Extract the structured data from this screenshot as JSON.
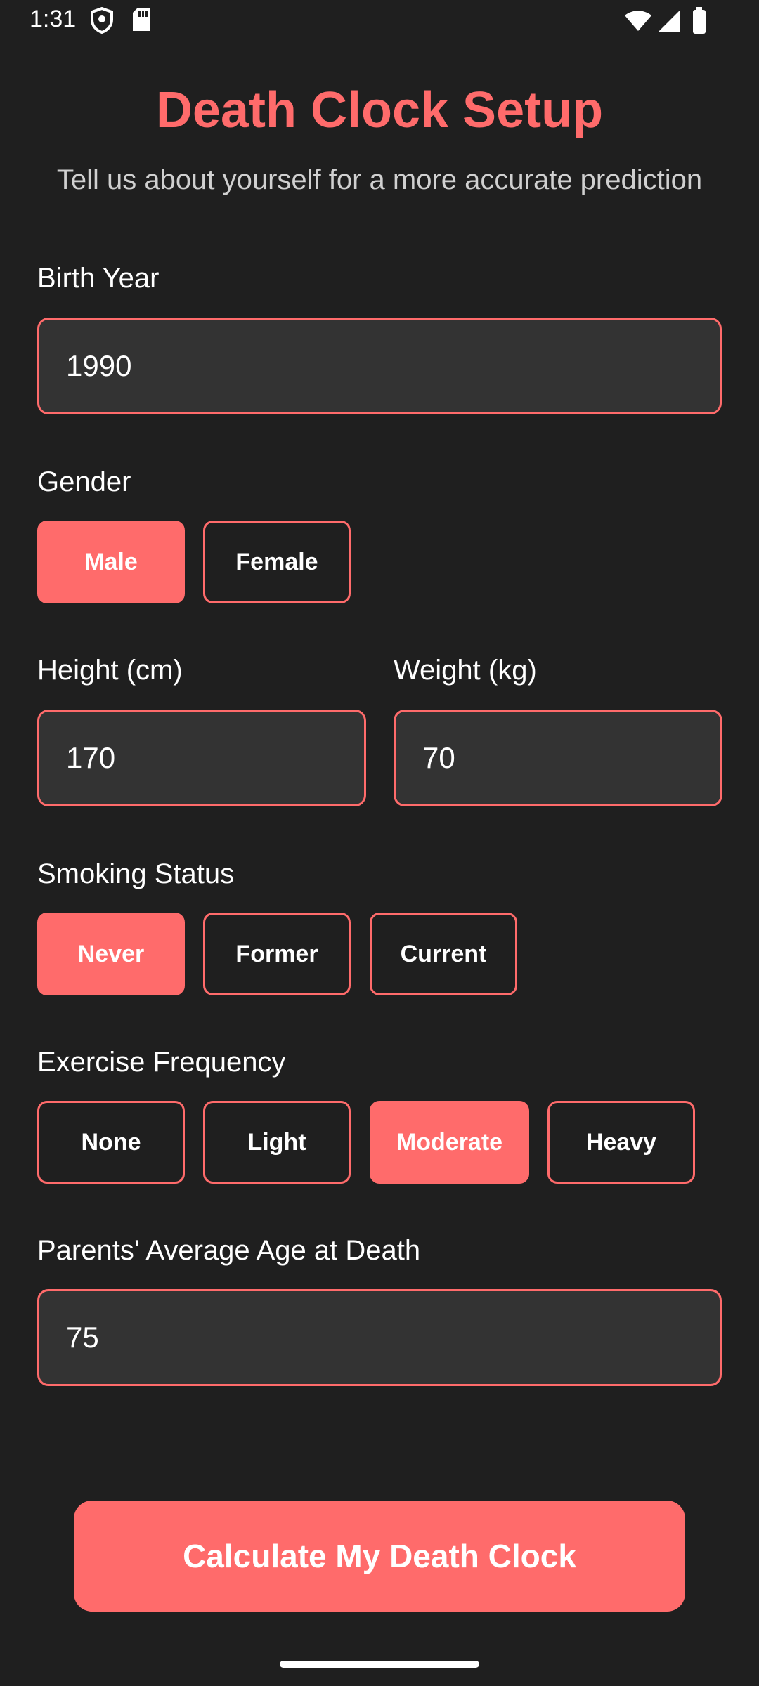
{
  "status_bar": {
    "time": "1:31",
    "icons": [
      "shield-icon",
      "sd-card-icon",
      "wifi-icon",
      "signal-icon",
      "battery-icon"
    ]
  },
  "header": {
    "title": "Death Clock Setup",
    "subtitle": "Tell us about yourself for a more accurate prediction"
  },
  "form": {
    "birth_year": {
      "label": "Birth Year",
      "value": "1990"
    },
    "gender": {
      "label": "Gender",
      "options": [
        "Male",
        "Female"
      ],
      "selected": "Male"
    },
    "height": {
      "label": "Height (cm)",
      "value": "170"
    },
    "weight": {
      "label": "Weight (kg)",
      "value": "70"
    },
    "smoking": {
      "label": "Smoking Status",
      "options": [
        "Never",
        "Former",
        "Current"
      ],
      "selected": "Never"
    },
    "exercise": {
      "label": "Exercise Frequency",
      "options": [
        "None",
        "Light",
        "Moderate",
        "Heavy"
      ],
      "selected": "Moderate"
    },
    "parents_age": {
      "label": "Parents' Average Age at Death",
      "value": "75"
    }
  },
  "cta": {
    "label": "Calculate My Death Clock"
  },
  "colors": {
    "background": "#1f1f1f",
    "accent": "#ff6b6b",
    "field_bg": "#333333",
    "subtitle": "#d0d0d0"
  }
}
